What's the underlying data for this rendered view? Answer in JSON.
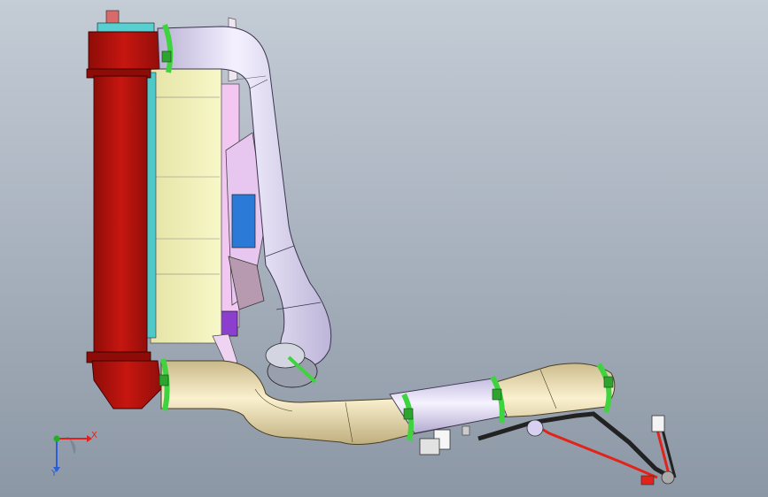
{
  "viewport": {
    "background_top": "#c4ccd6",
    "background_bottom": "#8c97a5"
  },
  "colors": {
    "radiator": "#c0140f",
    "intercooler_pipe": "#d9d3ee",
    "turbo_pipe": "#e9d7a6",
    "hose_clamp": "#3fd33f",
    "wire_red": "#e2231a",
    "wire_black": "#222222",
    "fan_shroud": "#f1f0b8",
    "fan_panel": "#f2c8f2"
  },
  "triad": {
    "x_label": "X",
    "y_label": "Y",
    "x_color": "#e02020",
    "y_color": "#2a5fd8",
    "z_color": "#20b020",
    "icon": "coordinate-triad-icon"
  }
}
